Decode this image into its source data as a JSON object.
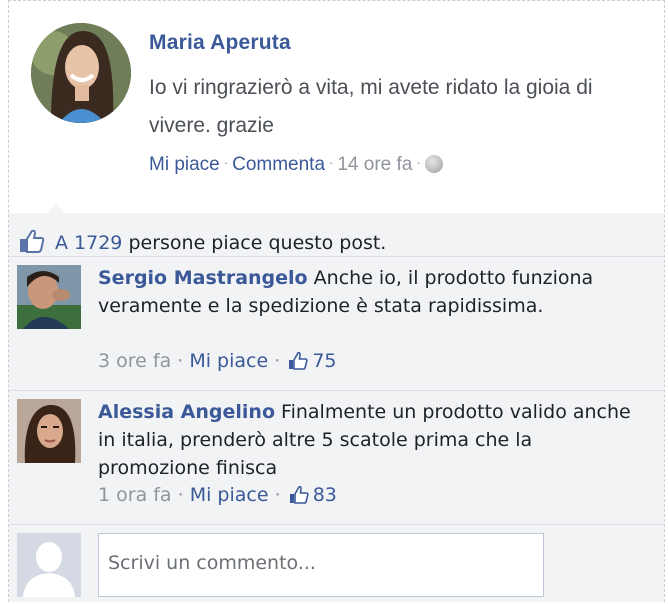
{
  "post": {
    "author": "Maria Aperuta",
    "text": "Io vi ringrazierò a vita, mi avete ridato la gioia di vivere. grazie",
    "like_label": "Mi piace",
    "comment_label": "Commenta",
    "time": "14 ore fa",
    "privacy_icon": "globe-icon"
  },
  "likes": {
    "prefix": "A",
    "count": "1729",
    "suffix": "persone piace questo post."
  },
  "comments": [
    {
      "name": "Sergio Mastrangelo",
      "text": "Anche io, il prodotto funziona veramente e la spedizione è stata rapidissima.",
      "time": "3 ore fa",
      "like_label": "Mi piace",
      "like_count": "75"
    },
    {
      "name": "Alessia Angelino",
      "text": "Finalmente un prodotto valido anche in italia, prenderò altre 5 scatole prima che la promozione finisca",
      "time": "1 ora fa",
      "like_label": "Mi piace",
      "like_count": "83"
    }
  ],
  "reply": {
    "placeholder": "Scrivi un commento..."
  },
  "colors": {
    "link": "#3b5998",
    "muted": "#90949c",
    "panel": "#f2f3f5"
  }
}
